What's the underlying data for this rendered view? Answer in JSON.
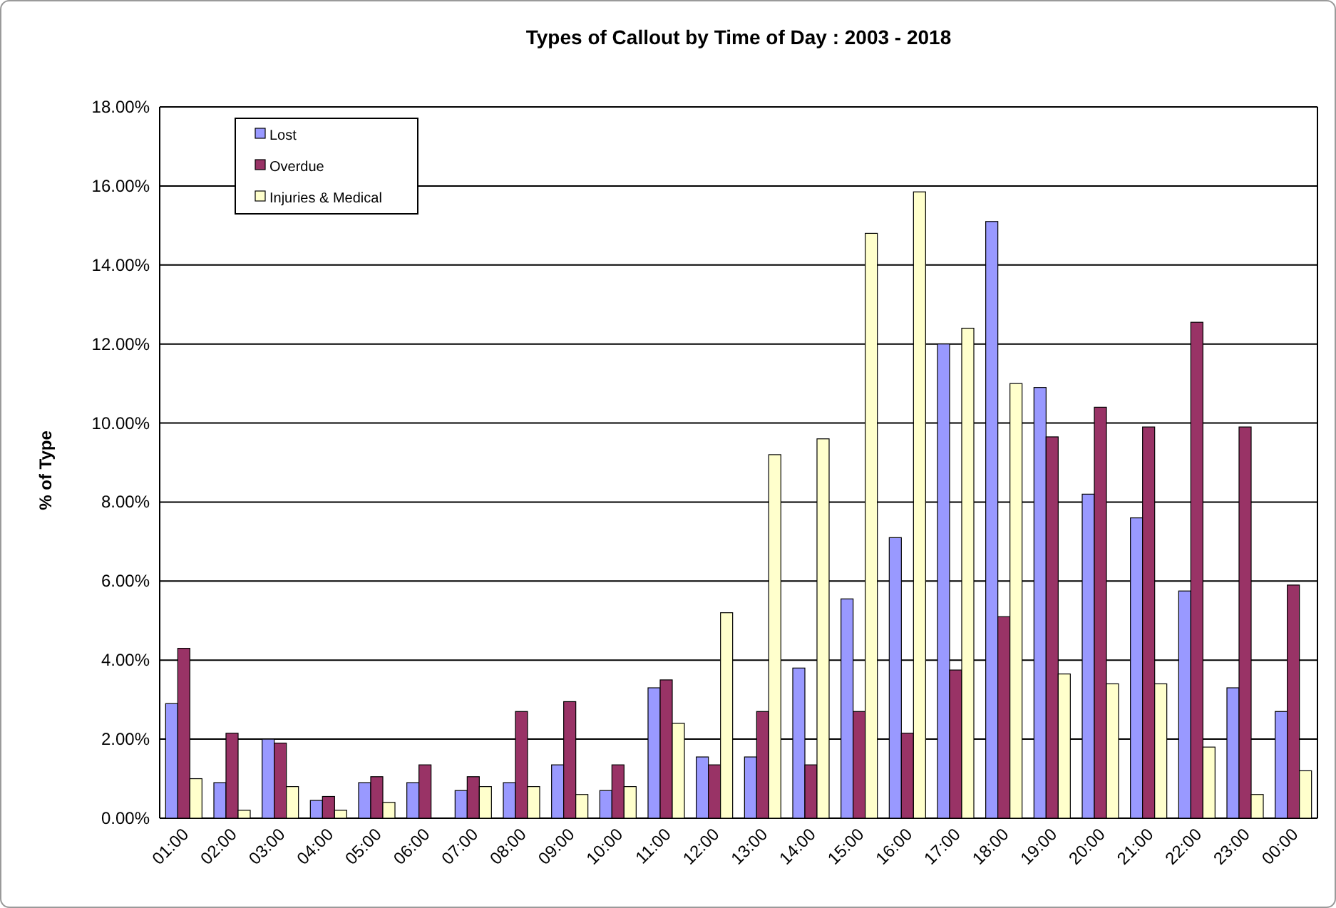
{
  "chart_data": {
    "type": "bar",
    "title": "Types of Callout by Time of Day : 2003  - 2018",
    "ylabel": "% of Type",
    "categories": [
      "01:00",
      "02:00",
      "03:00",
      "04:00",
      "05:00",
      "06:00",
      "07:00",
      "08:00",
      "09:00",
      "10:00",
      "11:00",
      "12:00",
      "13:00",
      "14:00",
      "15:00",
      "16:00",
      "17:00",
      "18:00",
      "19:00",
      "20:00",
      "21:00",
      "22:00",
      "23:00",
      "00:00"
    ],
    "series": [
      {
        "name": "Lost",
        "color": "#9999ff",
        "values": [
          2.9,
          0.9,
          2.0,
          0.45,
          0.9,
          0.9,
          0.7,
          0.9,
          1.35,
          0.7,
          3.3,
          1.55,
          1.55,
          3.8,
          5.55,
          7.1,
          12.0,
          15.1,
          10.9,
          8.2,
          7.6,
          5.75,
          3.3,
          2.7
        ]
      },
      {
        "name": "Overdue",
        "color": "#993366",
        "values": [
          4.3,
          2.15,
          1.9,
          0.55,
          1.05,
          1.35,
          1.05,
          2.7,
          2.95,
          1.35,
          3.5,
          1.35,
          2.7,
          1.35,
          2.7,
          2.15,
          3.75,
          5.1,
          9.65,
          10.4,
          9.9,
          12.55,
          9.9,
          5.9
        ]
      },
      {
        "name": "Injuries & Medical",
        "color": "#ffffcc",
        "values": [
          1.0,
          0.2,
          0.8,
          0.2,
          0.4,
          0.0,
          0.8,
          0.8,
          0.6,
          0.8,
          2.4,
          5.2,
          9.2,
          9.6,
          14.8,
          15.85,
          12.4,
          11.0,
          3.65,
          3.4,
          3.4,
          1.8,
          0.6,
          1.2
        ]
      }
    ],
    "ylim": [
      0,
      18
    ],
    "grid": true,
    "legend": true,
    "yticks": [
      {
        "value": 0,
        "label": "0.00%"
      },
      {
        "value": 2,
        "label": "2.00%"
      },
      {
        "value": 4,
        "label": "4.00%"
      },
      {
        "value": 6,
        "label": "6.00%"
      },
      {
        "value": 8,
        "label": "8.00%"
      },
      {
        "value": 10,
        "label": "10.00%"
      },
      {
        "value": 12,
        "label": "12.00%"
      },
      {
        "value": 14,
        "label": "14.00%"
      },
      {
        "value": 16,
        "label": "16.00%"
      },
      {
        "value": 18,
        "label": "18.00%"
      }
    ]
  }
}
